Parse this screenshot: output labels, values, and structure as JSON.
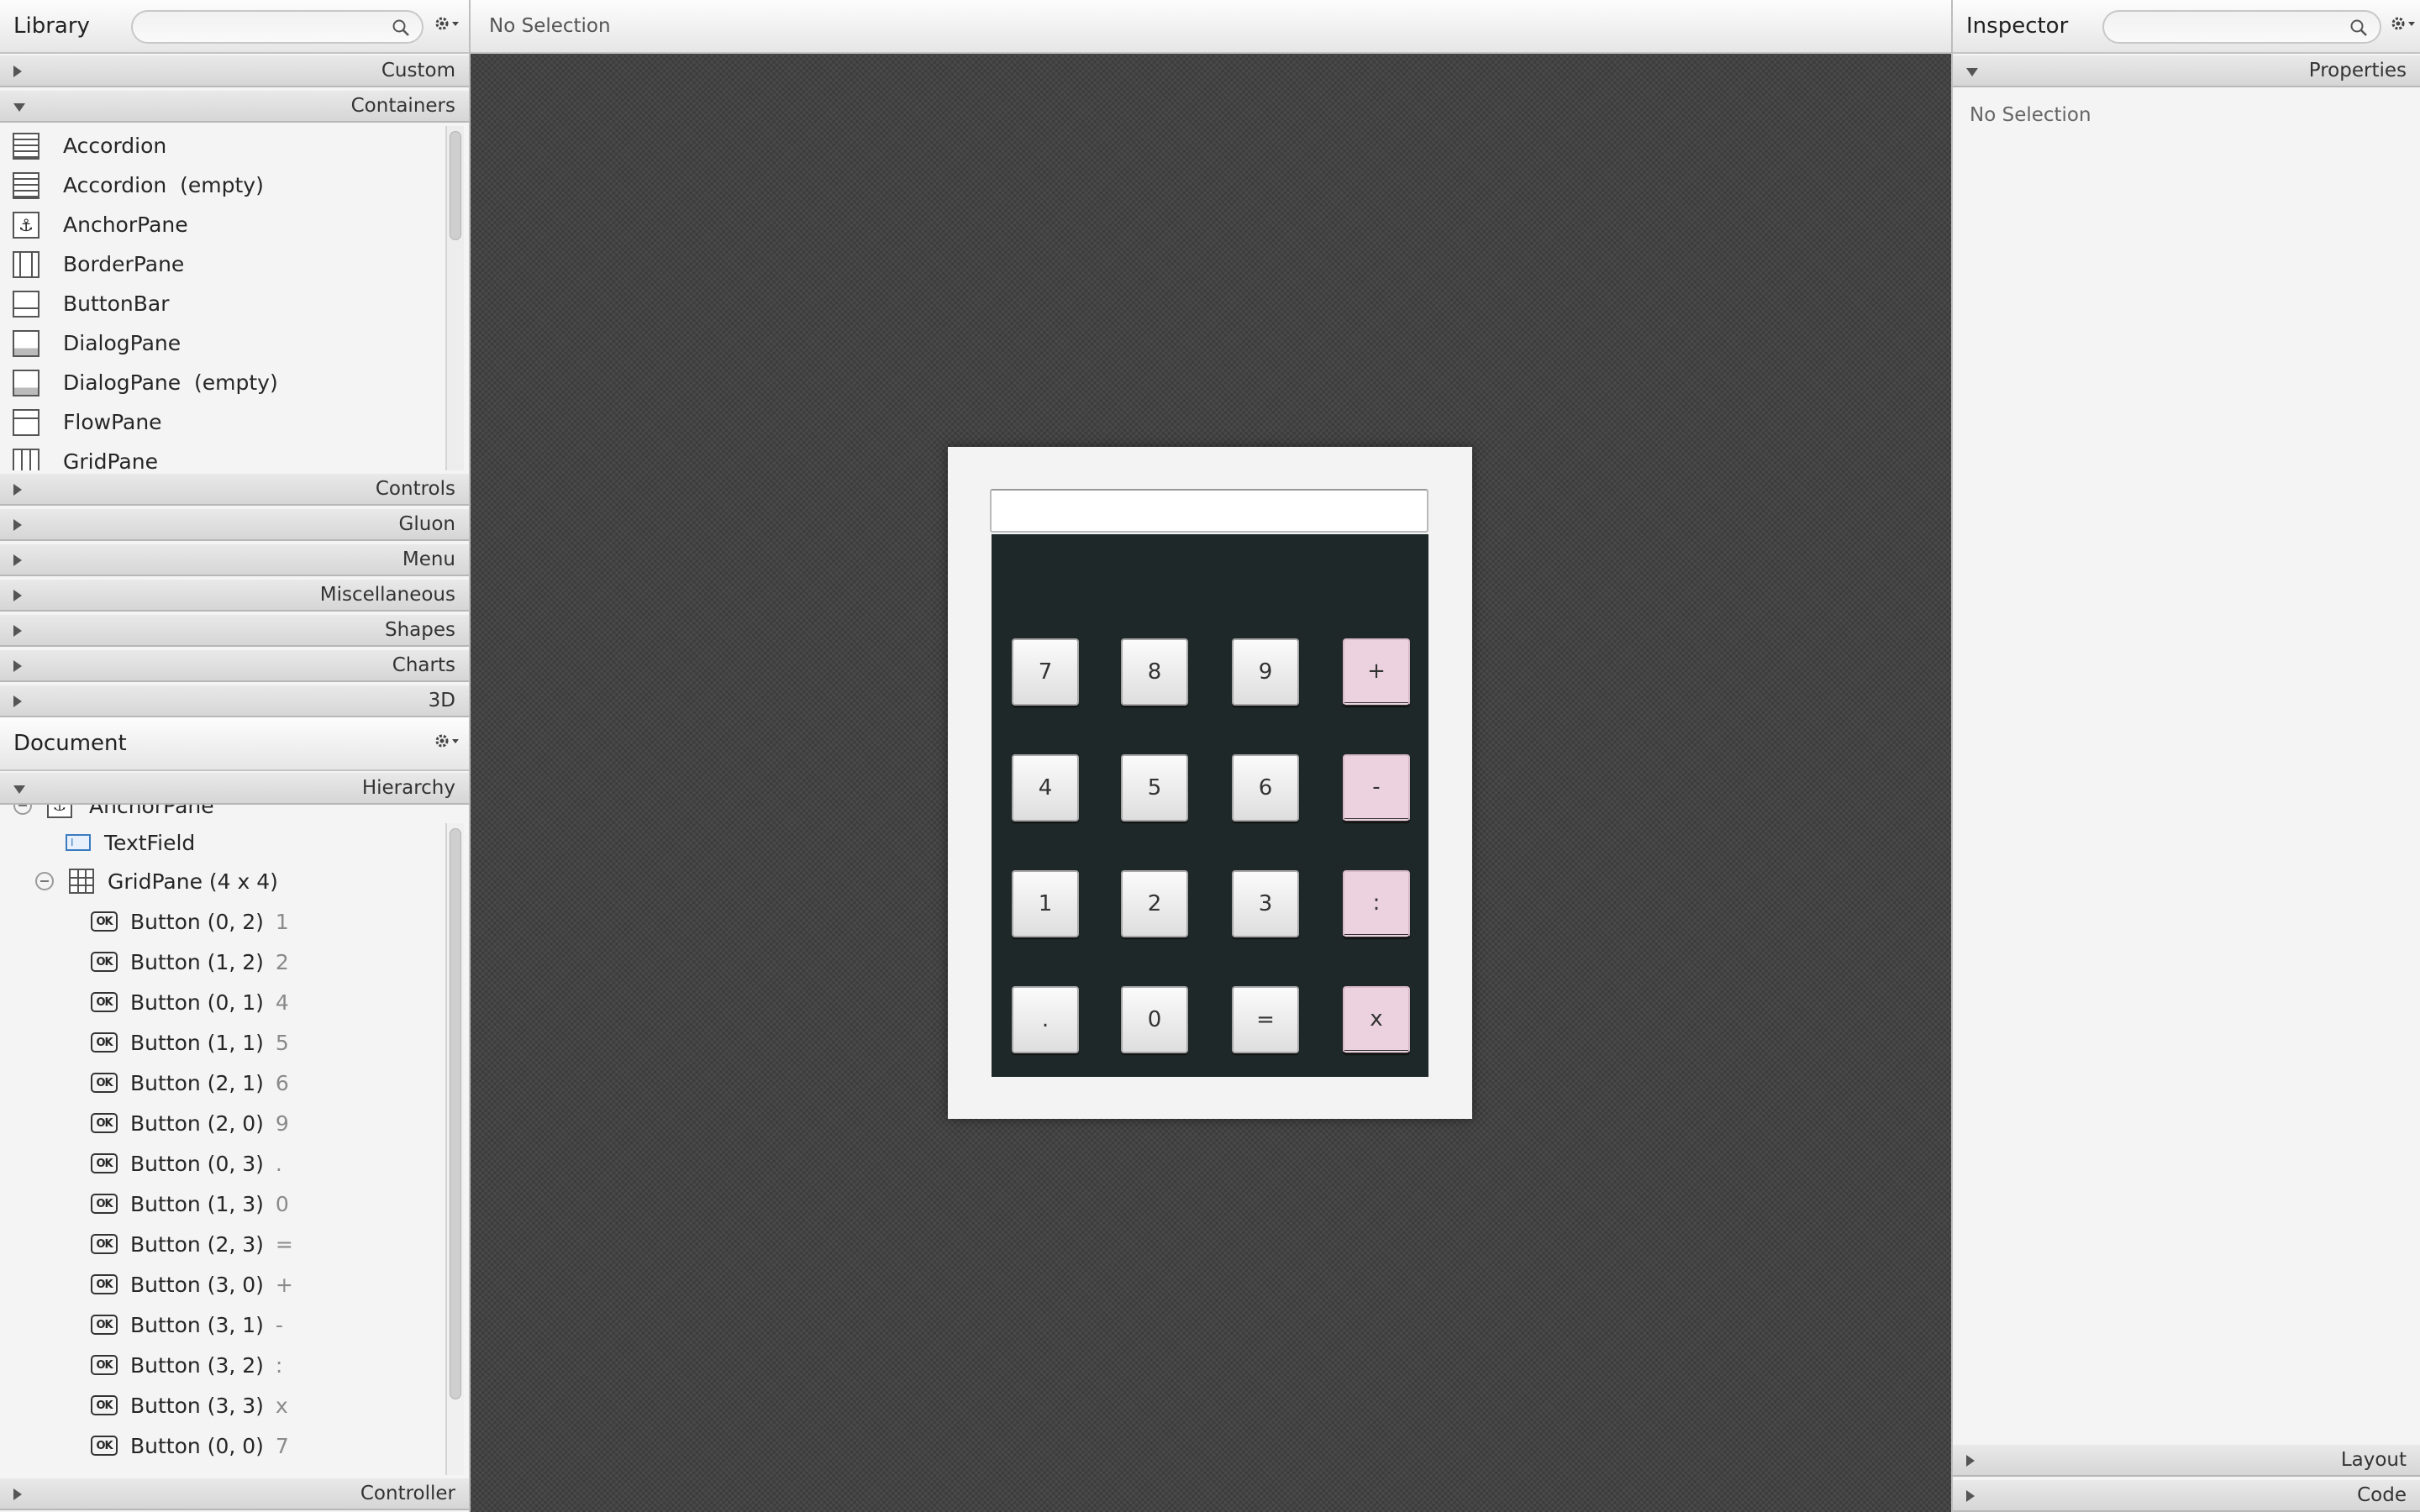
{
  "library": {
    "title": "Library",
    "search_placeholder": "",
    "sections_top": [
      {
        "label": "Custom",
        "expanded": false
      },
      {
        "label": "Containers",
        "expanded": true
      }
    ],
    "container_items": [
      {
        "label": "Accordion",
        "icon": "accordion-icon"
      },
      {
        "label": "Accordion  (empty)",
        "icon": "accordion-icon"
      },
      {
        "label": "AnchorPane",
        "icon": "anchor-icon"
      },
      {
        "label": "BorderPane",
        "icon": "borderpane-icon"
      },
      {
        "label": "ButtonBar",
        "icon": "buttonbar-icon"
      },
      {
        "label": "DialogPane",
        "icon": "dialogpane-icon"
      },
      {
        "label": "DialogPane  (empty)",
        "icon": "dialogpane-icon"
      },
      {
        "label": "FlowPane",
        "icon": "flowpane-icon"
      },
      {
        "label": "GridPane",
        "icon": "gridpane-icon"
      }
    ],
    "sections_bottom": [
      "Controls",
      "Gluon",
      "Menu",
      "Miscellaneous",
      "Shapes",
      "Charts",
      "3D"
    ]
  },
  "document": {
    "title": "Document",
    "hierarchy_label": "Hierarchy",
    "controller_label": "Controller",
    "tree": {
      "root": "AnchorPane",
      "textfield": "TextField",
      "gridpane": "GridPane (4 x 4)",
      "buttons": [
        {
          "label": "Button (0, 2)",
          "value": "1"
        },
        {
          "label": "Button (1, 2)",
          "value": "2"
        },
        {
          "label": "Button (0, 1)",
          "value": "4"
        },
        {
          "label": "Button (1, 1)",
          "value": "5"
        },
        {
          "label": "Button (2, 1)",
          "value": "6"
        },
        {
          "label": "Button (2, 0)",
          "value": "9"
        },
        {
          "label": "Button (0, 3)",
          "value": "."
        },
        {
          "label": "Button (1, 3)",
          "value": "0"
        },
        {
          "label": "Button (2, 3)",
          "value": "="
        },
        {
          "label": "Button (3, 0)",
          "value": "+"
        },
        {
          "label": "Button (3, 1)",
          "value": "-"
        },
        {
          "label": "Button (3, 2)",
          "value": ":"
        },
        {
          "label": "Button (3, 3)",
          "value": "x"
        },
        {
          "label": "Button (0, 0)",
          "value": "7"
        }
      ]
    }
  },
  "canvas": {
    "status": "No Selection",
    "calculator": {
      "field_value": "",
      "keys": [
        [
          "7",
          "8",
          "9",
          "+"
        ],
        [
          "4",
          "5",
          "6",
          "-"
        ],
        [
          "1",
          "2",
          "3",
          ":"
        ],
        [
          ".",
          "0",
          "=",
          "x"
        ]
      ]
    }
  },
  "inspector": {
    "title": "Inspector",
    "search_placeholder": "",
    "properties_label": "Properties",
    "body": "No Selection",
    "layout_label": "Layout",
    "code_label": "Code"
  },
  "colors": {
    "canvas_bg": "#4a4a4a",
    "grid_bg": "#1e2828",
    "operator_key": "#ebd2de"
  }
}
